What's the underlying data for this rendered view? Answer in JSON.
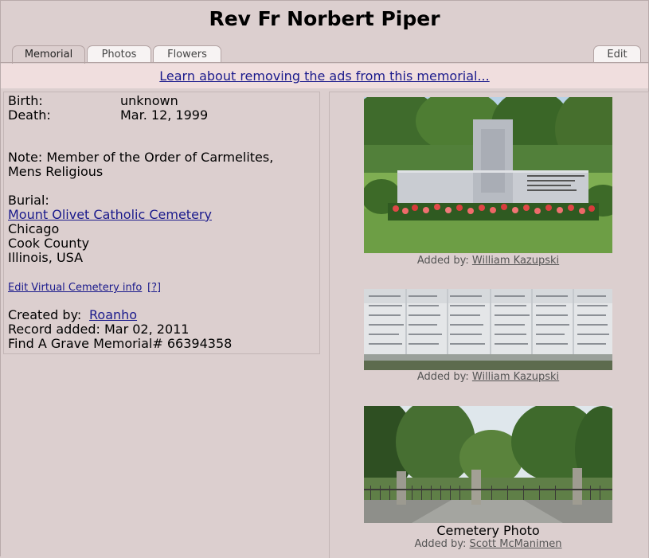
{
  "page": {
    "title": "Rev Fr Norbert Piper"
  },
  "tabs": [
    {
      "label": "Memorial",
      "active": true
    },
    {
      "label": "Photos",
      "active": false
    },
    {
      "label": "Flowers",
      "active": false
    }
  ],
  "edit_tab": {
    "label": "Edit"
  },
  "ad_banner": {
    "text": "Learn about removing the ads from this memorial..."
  },
  "memorial": {
    "birth_label": "Birth:",
    "birth_value": "unknown",
    "death_label": "Death:",
    "death_value": "Mar. 12, 1999",
    "note_line1": "Note: Member of the Order of Carmelites,",
    "note_line2": "Mens Religious",
    "burial_label": "Burial:",
    "cemetery_link": "Mount Olivet Catholic Cemetery",
    "city": "Chicago",
    "county": "Cook County",
    "state": "Illinois, USA",
    "virtual_cemetery_link": "Edit Virtual Cemetery info",
    "help_link": "[?]",
    "created_by_label": "Created by:",
    "created_by_user": "Roanho",
    "record_added": "Record added: Mar 02, 2011",
    "memorial_number": "Find A Grave Memorial# 66394358"
  },
  "photos": [
    {
      "title": "",
      "added_by_label": "Added by:",
      "added_by": "William Kazupski"
    },
    {
      "title": "",
      "added_by_label": "Added by:",
      "added_by": "William Kazupski"
    },
    {
      "title": "Cemetery Photo",
      "added_by_label": "Added by:",
      "added_by": "Scott McManimen"
    }
  ],
  "colors": {
    "background": "#dccfcf",
    "ad_banner_bg": "#f0dede",
    "link": "#1a1a8c"
  }
}
